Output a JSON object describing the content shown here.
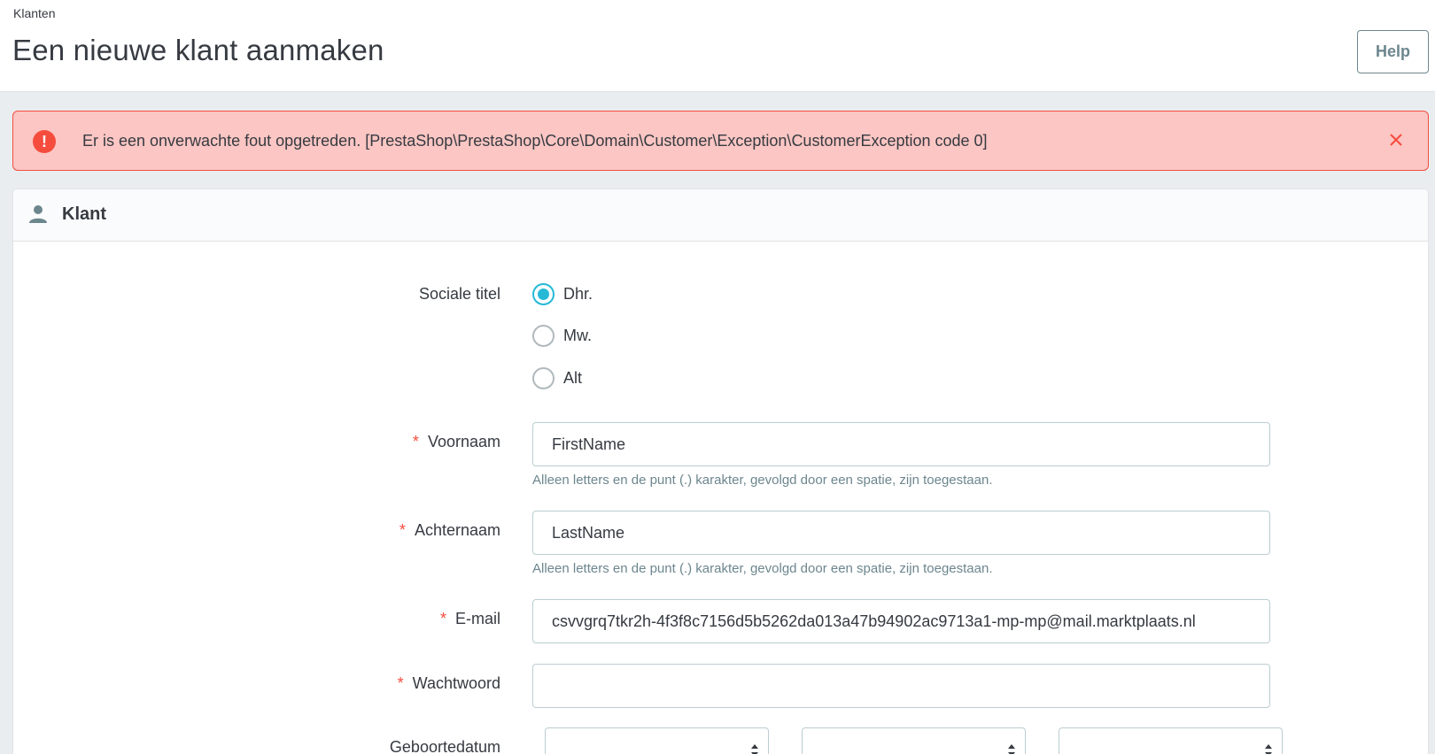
{
  "header": {
    "breadcrumb": "Klanten",
    "title": "Een nieuwe klant aanmaken",
    "help_label": "Help"
  },
  "alert": {
    "icon": "exclamation-circle-icon",
    "message": "Er is een onverwachte fout opgetreden. [PrestaShop\\PrestaShop\\Core\\Domain\\Customer\\Exception\\CustomerException code 0]",
    "color": "#f54c3e"
  },
  "card": {
    "icon": "person-icon",
    "title": "Klant"
  },
  "form": {
    "social_title": {
      "label": "Sociale titel",
      "options": [
        {
          "label": "Dhr.",
          "checked": true
        },
        {
          "label": "Mw.",
          "checked": false
        },
        {
          "label": "Alt",
          "checked": false
        }
      ]
    },
    "required_marker": "*",
    "firstname": {
      "label": "Voornaam",
      "value": "FirstName",
      "hint": "Alleen letters en de punt (.) karakter, gevolgd door een spatie, zijn toegestaan."
    },
    "lastname": {
      "label": "Achternaam",
      "value": "LastName",
      "hint": "Alleen letters en de punt (.) karakter, gevolgd door een spatie, zijn toegestaan."
    },
    "email": {
      "label": "E-mail",
      "value": "csvvgrq7tkr2h-4f3f8c7156d5b5262da013a47b94902ac9713a1-mp-mp@mail.marktplaats.nl"
    },
    "password": {
      "label": "Wachtwoord",
      "value": ""
    },
    "birthday": {
      "label": "Geboortedatum",
      "day": "",
      "month": "",
      "year": ""
    }
  },
  "colors": {
    "accent": "#25b9d7",
    "error": "#f54c3e",
    "error_bg": "#fbc6c3",
    "text": "#363a41",
    "muted": "#6c868e"
  }
}
